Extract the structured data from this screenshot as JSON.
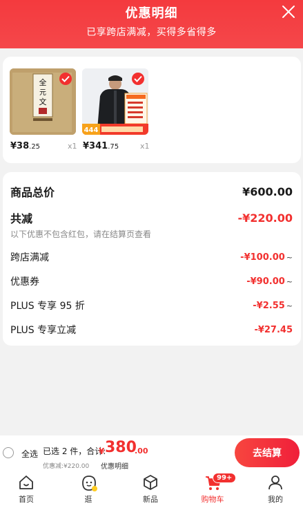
{
  "header": {
    "title": "优惠明细",
    "subtitle": "已享跨店满减，买得多省得多"
  },
  "products": [
    {
      "price_int": "¥38",
      "price_dec": ".25",
      "qty": "x1",
      "image": "book-cover",
      "cover_text": "全元文",
      "selected": true
    },
    {
      "price_int": "¥341",
      "price_dec": ".75",
      "qty": "x1",
      "image": "jacket-model-photo",
      "promo_price": "444",
      "selected": true
    }
  ],
  "summary": {
    "total_label": "商品总价",
    "total_value": "¥600.00",
    "reduce_label": "共减",
    "reduce_value": "-¥220.00",
    "note": "以下优惠不包含红包，请在结算页查看",
    "items": [
      {
        "label": "跨店满减",
        "value": "-¥100.00",
        "tilde": "~"
      },
      {
        "label": "优惠券",
        "value": "-¥90.00",
        "tilde": "~"
      },
      {
        "label": "PLUS 专享 95 折",
        "value": "-¥2.55",
        "tilde": "~"
      },
      {
        "label": "PLUS 专享立减",
        "value": "-¥27.45",
        "tilde": ""
      }
    ]
  },
  "bottom": {
    "select_all": "全选",
    "selected_info": "已选 2 件，合计:",
    "currency": "¥",
    "total_int": "380",
    "total_dec": ".00",
    "discount_note": "优惠减:¥220.00",
    "detail_link": "优惠明细",
    "checkout": "去结算"
  },
  "tabs": [
    {
      "label": "首页",
      "icon": "home-icon",
      "active": false
    },
    {
      "label": "逛",
      "icon": "stroll-face-icon",
      "active": false
    },
    {
      "label": "新品",
      "icon": "new-box-icon",
      "active": false
    },
    {
      "label": "购物车",
      "icon": "cart-icon",
      "active": true,
      "badge": "99+"
    },
    {
      "label": "我的",
      "icon": "profile-icon",
      "active": false
    }
  ],
  "colors": {
    "accent": "#f2302f",
    "header": "#f43a3e"
  }
}
